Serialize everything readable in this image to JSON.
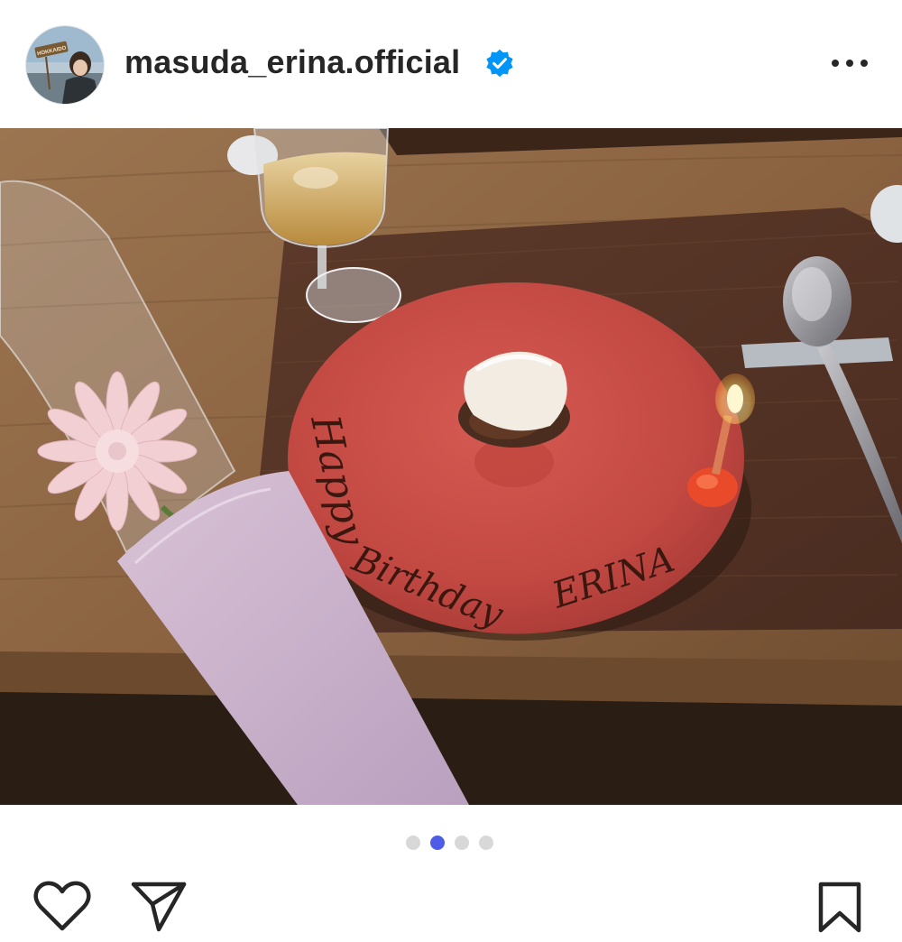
{
  "post": {
    "username": "masuda_erina.official",
    "verified": true
  },
  "avatar": {
    "sign_text": "HOKKAIDO"
  },
  "photo": {
    "plate_text_line1": "Happy",
    "plate_text_line2": "Birthday",
    "plate_text_line3": "ERINA"
  },
  "carousel": {
    "count": 4,
    "active_index": 1,
    "active_color": "#4e5ce8",
    "inactive_color": "#d8d8d8"
  },
  "icons": {
    "more": "more-options-icon",
    "like": "heart-icon",
    "share": "paper-plane-icon",
    "save": "bookmark-icon",
    "verified": "verified-badge-icon"
  },
  "colors": {
    "accent": "#0095f6",
    "text": "#262626"
  }
}
